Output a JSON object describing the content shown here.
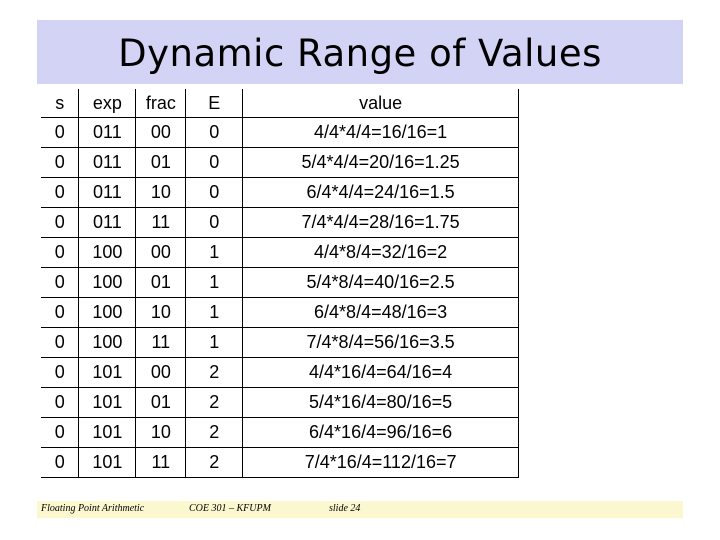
{
  "slide": {
    "title": "Dynamic Range of Values"
  },
  "table": {
    "headers": [
      "s",
      "exp",
      "frac",
      "E",
      "value"
    ],
    "rows": [
      [
        "0",
        "011",
        "00",
        "0",
        "4/4*4/4=16/16=1"
      ],
      [
        "0",
        "011",
        "01",
        "0",
        "5/4*4/4=20/16=1.25"
      ],
      [
        "0",
        "011",
        "10",
        "0",
        "6/4*4/4=24/16=1.5"
      ],
      [
        "0",
        "011",
        "11",
        "0",
        "7/4*4/4=28/16=1.75"
      ],
      [
        "0",
        "100",
        "00",
        "1",
        "4/4*8/4=32/16=2"
      ],
      [
        "0",
        "100",
        "01",
        "1",
        "5/4*8/4=40/16=2.5"
      ],
      [
        "0",
        "100",
        "10",
        "1",
        "6/4*8/4=48/16=3"
      ],
      [
        "0",
        "100",
        "11",
        "1",
        "7/4*8/4=56/16=3.5"
      ],
      [
        "0",
        "101",
        "00",
        "2",
        "4/4*16/4=64/16=4"
      ],
      [
        "0",
        "101",
        "01",
        "2",
        "5/4*16/4=80/16=5"
      ],
      [
        "0",
        "101",
        "10",
        "2",
        "6/4*16/4=96/16=6"
      ],
      [
        "0",
        "101",
        "11",
        "2",
        "7/4*16/4=112/16=7"
      ]
    ]
  },
  "footer": {
    "left": "Floating Point Arithmetic",
    "center": "COE 301 – KFUPM",
    "right": "slide 24"
  },
  "colors": {
    "title_bar": "#d3d3f6",
    "footer_bar": "#fbf7cf"
  }
}
